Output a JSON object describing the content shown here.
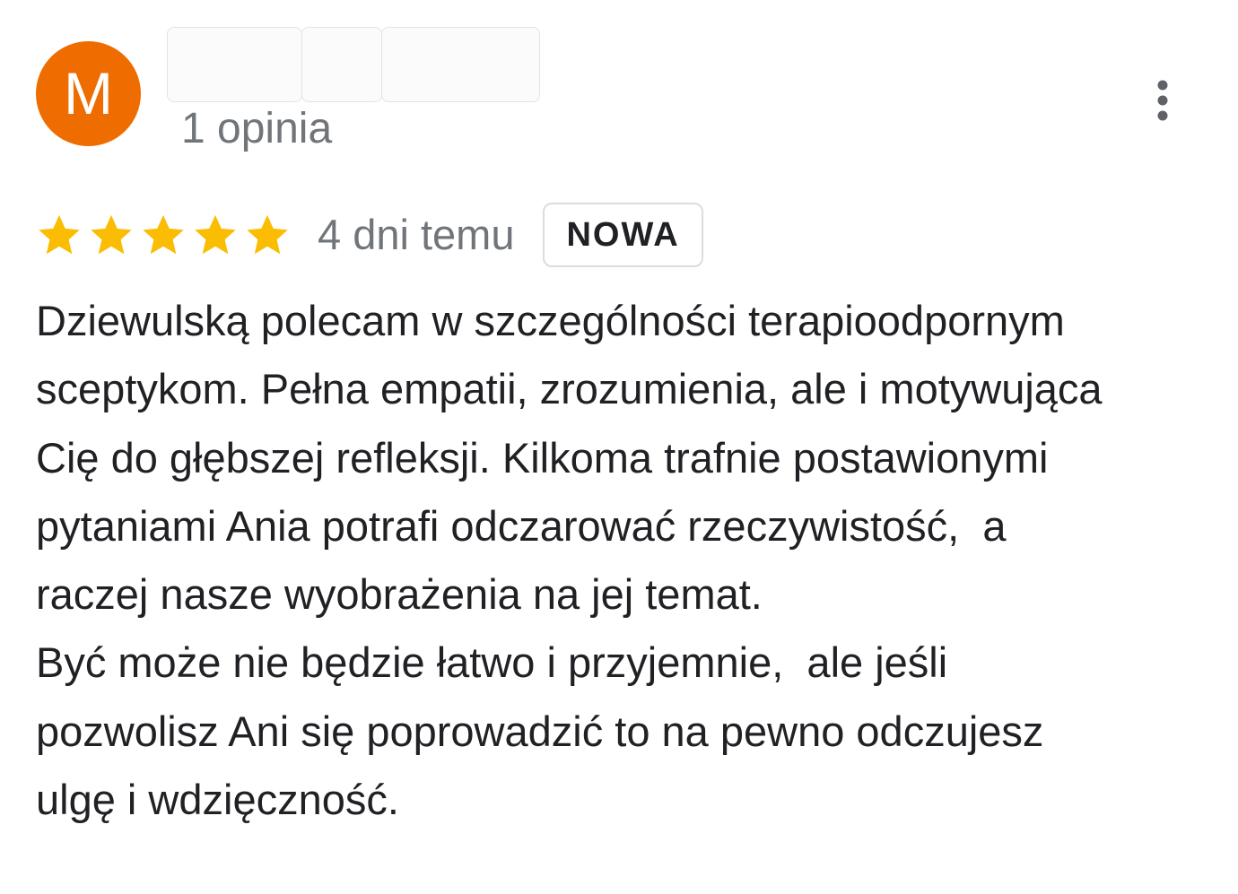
{
  "reviewer": {
    "avatar_letter": "M",
    "avatar_color": "#ef6c00",
    "review_count": "1 opinia"
  },
  "menu": {
    "icon": "more-vert-icon"
  },
  "rating": {
    "stars": 5,
    "max_stars": 5,
    "star_color": "#fbbc04",
    "date": "4 dni temu",
    "badge": "NOWA"
  },
  "review": {
    "lines": [
      "Dziewulską polecam w szczególności terapioodpornym",
      "sceptykom. Pełna empatii, zrozumienia, ale i motywująca",
      "Cię do głębszej refleksji. Kilkoma trafnie postawionymi",
      "pytaniami Ania potrafi odczarować rzeczywistość,  a",
      "raczej nasze wyobrażenia na jej temat.",
      "Być może nie będzie łatwo i przyjemnie,  ale jeśli",
      "pozwolisz Ani się poprowadzić to na pewno odczujesz",
      "ulgę i wdzięczność."
    ]
  }
}
